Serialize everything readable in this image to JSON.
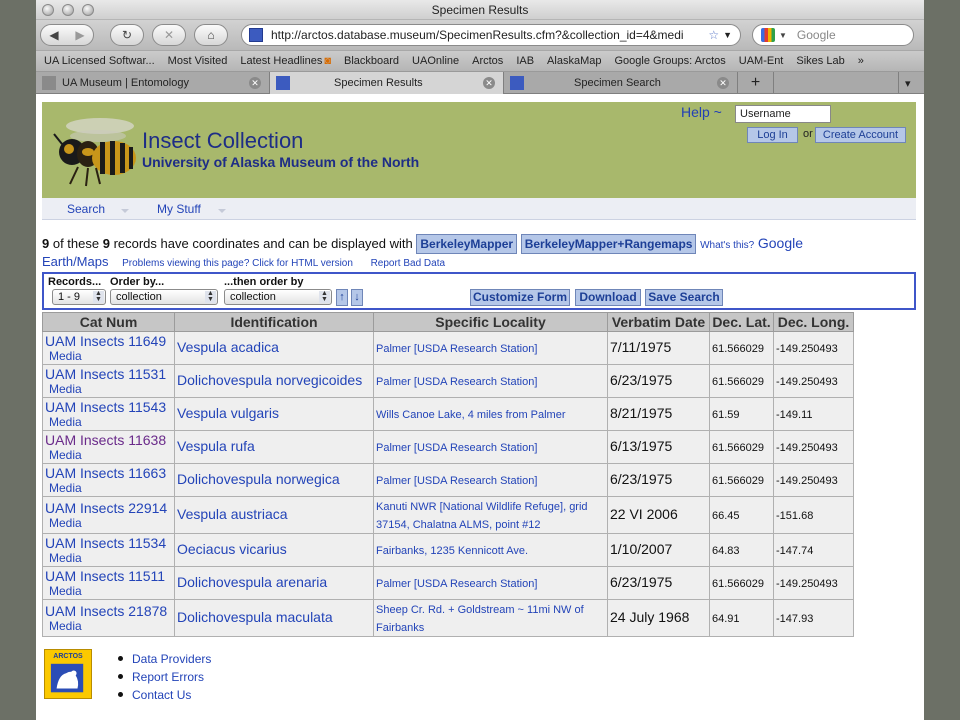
{
  "window": {
    "title": "Specimen Results"
  },
  "toolbar": {
    "url": "http://arctos.database.museum/SpecimenResults.cfm?&collection_id=4&medi",
    "search_placeholder": "Google"
  },
  "bookmarks": [
    "UA Licensed Softwar...",
    "Most Visited",
    "Latest Headlines",
    "Blackboard",
    "UAOnline",
    "Arctos",
    "IAB",
    "AlaskaMap",
    "Google Groups: Arctos",
    "UAM-Ent",
    "Sikes Lab"
  ],
  "tabs": [
    {
      "label": "UA Museum | Entomology"
    },
    {
      "label": "Specimen Results"
    },
    {
      "label": "Specimen Search"
    }
  ],
  "header": {
    "title": "Insect Collection",
    "subtitle": "University of Alaska Museum of the North",
    "help": "Help ~",
    "username": "Username",
    "login": "Log In",
    "or": "or",
    "create_account": "Create Account"
  },
  "menu": {
    "search": "Search",
    "mystuff": "My Stuff"
  },
  "summary": {
    "count1": "9",
    "text1": " of these ",
    "count2": "9",
    "text2": " records have coordinates and can be displayed with ",
    "berkeley": "BerkeleyMapper",
    "berkeley_range": "BerkeleyMapper+Rangemaps",
    "whats_this": "What's this?",
    "google": "Google",
    "earth": "Earth/Maps",
    "problems": "Problems viewing this page? Click for HTML version",
    "report": "Report Bad Data"
  },
  "controls": {
    "records_label": "Records...",
    "records_value": "1 - 9",
    "order_label": "Order by...",
    "order_value": "collection",
    "then_label": "...then order by",
    "then_value": "collection",
    "up": "↑",
    "down": "↓",
    "customize": "Customize Form",
    "download": "Download",
    "save": "Save Search"
  },
  "table": {
    "headers": [
      "Cat Num",
      "Identification",
      "Specific Locality",
      "Verbatim Date",
      "Dec. Lat.",
      "Dec. Long."
    ],
    "media_label": "Media",
    "rows": [
      {
        "cat": "UAM Insects 11649",
        "ident": "Vespula acadica",
        "locality": "Palmer [USDA Research Station]",
        "date": "7/11/1975",
        "lat": "61.566029",
        "long": "-149.250493"
      },
      {
        "cat": "UAM Insects 11531",
        "ident": "Dolichovespula norvegicoides",
        "locality": "Palmer [USDA Research Station]",
        "date": "6/23/1975",
        "lat": "61.566029",
        "long": "-149.250493"
      },
      {
        "cat": "UAM Insects 11543",
        "ident": "Vespula vulgaris",
        "locality": "Wills Canoe Lake, 4 miles from Palmer",
        "date": "8/21/1975",
        "lat": "61.59",
        "long": "-149.11"
      },
      {
        "cat": "UAM Insects 11638",
        "ident": "Vespula rufa",
        "locality": "Palmer [USDA Research Station]",
        "date": "6/13/1975",
        "lat": "61.566029",
        "long": "-149.250493"
      },
      {
        "cat": "UAM Insects 11663",
        "ident": "Dolichovespula norwegica",
        "locality": "Palmer [USDA Research Station]",
        "date": "6/23/1975",
        "lat": "61.566029",
        "long": "-149.250493"
      },
      {
        "cat": "UAM Insects 22914",
        "ident": "Vespula austriaca",
        "locality": "Kanuti NWR [National Wildlife Refuge], grid 37154, Chalatna ALMS, point #12",
        "date": "22 VI 2006",
        "lat": "66.45",
        "long": "-151.68"
      },
      {
        "cat": "UAM Insects 11534",
        "ident": "Oeciacus vicarius",
        "locality": "Fairbanks, 1235 Kennicott Ave.",
        "date": "1/10/2007",
        "lat": "64.83",
        "long": "-147.74"
      },
      {
        "cat": "UAM Insects 11511",
        "ident": "Dolichovespula arenaria",
        "locality": "Palmer [USDA Research Station]",
        "date": "6/23/1975",
        "lat": "61.566029",
        "long": "-149.250493"
      },
      {
        "cat": "UAM Insects 21878",
        "ident": "Dolichovespula maculata",
        "locality": "Sheep Cr. Rd. + Goldstream ~ 11mi NW of Fairbanks",
        "date": "24 July 1968",
        "lat": "64.91",
        "long": "-147.93"
      }
    ]
  },
  "footer": {
    "logo_text": "ARCTOS",
    "links": [
      "Data Providers",
      "Report Errors",
      "Contact Us"
    ]
  },
  "colors": {
    "header_bg": "#a8b86c",
    "link": "#2344b8",
    "title": "#1e2d86",
    "visited": "#6a2a8a"
  }
}
